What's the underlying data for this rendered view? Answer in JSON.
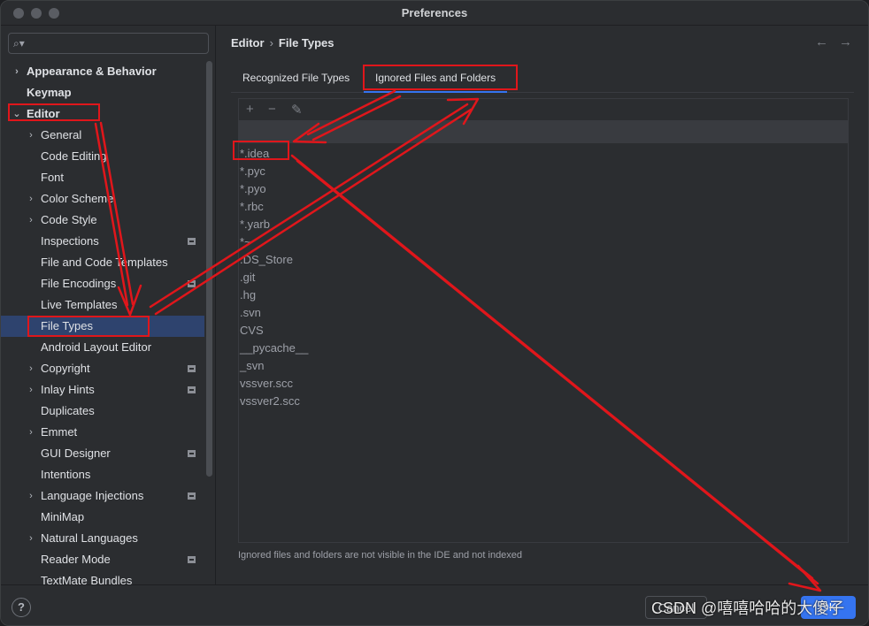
{
  "window": {
    "title": "Preferences"
  },
  "sidebar": {
    "search_placeholder": "",
    "items": [
      {
        "label": "Appearance & Behavior",
        "chevron": "›",
        "level": 0,
        "bold": true
      },
      {
        "label": "Keymap",
        "chevron": "",
        "level": 0,
        "bold": true
      },
      {
        "label": "Editor",
        "chevron": "⌄",
        "level": 0,
        "bold": true
      },
      {
        "label": "General",
        "chevron": "›",
        "level": 1
      },
      {
        "label": "Code Editing",
        "chevron": "",
        "level": 1
      },
      {
        "label": "Font",
        "chevron": "",
        "level": 1
      },
      {
        "label": "Color Scheme",
        "chevron": "›",
        "level": 1
      },
      {
        "label": "Code Style",
        "chevron": "›",
        "level": 1
      },
      {
        "label": "Inspections",
        "chevron": "",
        "level": 1,
        "project": true
      },
      {
        "label": "File and Code Templates",
        "chevron": "",
        "level": 1
      },
      {
        "label": "File Encodings",
        "chevron": "",
        "level": 1,
        "project": true
      },
      {
        "label": "Live Templates",
        "chevron": "",
        "level": 1
      },
      {
        "label": "File Types",
        "chevron": "",
        "level": 1,
        "selected": true
      },
      {
        "label": "Android Layout Editor",
        "chevron": "",
        "level": 1
      },
      {
        "label": "Copyright",
        "chevron": "›",
        "level": 1,
        "project": true
      },
      {
        "label": "Inlay Hints",
        "chevron": "›",
        "level": 1,
        "project": true
      },
      {
        "label": "Duplicates",
        "chevron": "",
        "level": 1
      },
      {
        "label": "Emmet",
        "chevron": "›",
        "level": 1
      },
      {
        "label": "GUI Designer",
        "chevron": "",
        "level": 1,
        "project": true
      },
      {
        "label": "Intentions",
        "chevron": "",
        "level": 1
      },
      {
        "label": "Language Injections",
        "chevron": "›",
        "level": 1,
        "project": true
      },
      {
        "label": "MiniMap",
        "chevron": "",
        "level": 1
      },
      {
        "label": "Natural Languages",
        "chevron": "›",
        "level": 1
      },
      {
        "label": "Reader Mode",
        "chevron": "",
        "level": 1,
        "project": true
      },
      {
        "label": "TextMate Bundles",
        "chevron": "",
        "level": 1
      }
    ]
  },
  "breadcrumb": {
    "parent": "Editor",
    "separator": "›",
    "current": "File Types"
  },
  "nav": {
    "back": "←",
    "forward": "→"
  },
  "tabs": [
    {
      "label": "Recognized File Types",
      "active": false
    },
    {
      "label": "Ignored Files and Folders",
      "active": true
    }
  ],
  "toolbar": {
    "add": "+",
    "remove": "−",
    "edit": "✎"
  },
  "ignored_items": [
    "*.idea",
    "*.pyc",
    "*.pyo",
    "*.rbc",
    "*.yarb",
    "*~",
    ".DS_Store",
    ".git",
    ".hg",
    ".svn",
    "CVS",
    "__pycache__",
    "_svn",
    "vssver.scc",
    "vssver2.scc"
  ],
  "note": "Ignored files and folders are not visible in the IDE and not indexed",
  "footer": {
    "help": "?",
    "cancel": "Cancel",
    "ok": "OK"
  },
  "watermark": "CSDN @嘻嘻哈哈的大傻子",
  "colors": {
    "accent": "#3574f0",
    "annotation": "#e0161b",
    "selection": "#2e436e"
  }
}
